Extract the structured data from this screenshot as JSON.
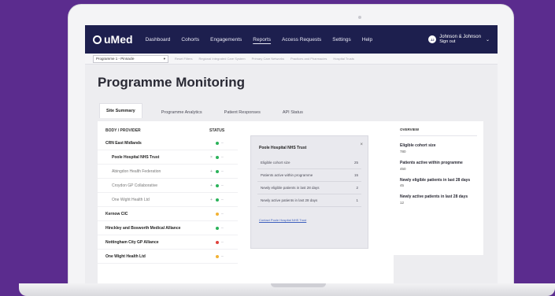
{
  "nav": {
    "logo": "uMed",
    "items": [
      "Dashboard",
      "Cohorts",
      "Engagements",
      "Reports",
      "Access Requests",
      "Settings",
      "Help"
    ],
    "active_index": 3,
    "user_initials": "JJ",
    "user_name": "Johnson & Johnson",
    "user_action": "Sign out"
  },
  "filterbar": {
    "programme_select": "Programme 1 - Pinnacle",
    "chips": [
      "Reset Filters",
      "Regional Integrated Care System",
      "Primary Care Networks",
      "Practices and Pharmacies",
      "Hospital Trusts"
    ]
  },
  "page_title": "Programme Monitoring",
  "tabs": [
    "Site Summary",
    "Programme Analytics",
    "Patient Responses",
    "API Status"
  ],
  "active_tab": 0,
  "table": {
    "headers": [
      "BODY / PROVIDER",
      "STATUS"
    ],
    "rows": [
      {
        "name": "CRN East Midlands",
        "level": "parent",
        "mark": "",
        "color": "#2bb35a"
      },
      {
        "name": "Poole Hospital NHS Trust",
        "level": "child",
        "selected": true,
        "mark": "×",
        "color": "#2bb35a"
      },
      {
        "name": "Abingdon Health Federation",
        "level": "child",
        "mark": "+",
        "color": "#2bb35a"
      },
      {
        "name": "Croydon GP Collaborative",
        "level": "child",
        "mark": "+",
        "color": "#2bb35a"
      },
      {
        "name": "One Wight Health Ltd",
        "level": "child",
        "mark": "+",
        "color": "#2bb35a"
      },
      {
        "name": "Kernow CIC",
        "level": "parent",
        "mark": "",
        "color": "#f2b234"
      },
      {
        "name": "Hinckley and Bosworth Medical Alliance",
        "level": "parent",
        "mark": "",
        "color": "#2bb35a"
      },
      {
        "name": "Nottingham City GP Alliance",
        "level": "parent",
        "mark": "",
        "color": "#e0423d"
      },
      {
        "name": "One Wight Health Ltd",
        "level": "parent",
        "mark": "",
        "color": "#f2b234"
      }
    ]
  },
  "detail": {
    "title": "Poole Hospital NHS Trust",
    "close": "×",
    "rows": [
      {
        "label": "Eligible cohort size",
        "value": "25"
      },
      {
        "label": "Patients active within programme",
        "value": "15"
      },
      {
        "label": "Newly eligible patients in last 28 days",
        "value": "2"
      },
      {
        "label": "Newly active patients in last 28 days",
        "value": "1"
      }
    ],
    "link": "Contact Poole Hospital NHS Trust"
  },
  "overview": {
    "heading": "OVERVIEW",
    "items": [
      {
        "label": "Eligible cohort size",
        "value": "780"
      },
      {
        "label": "Patients active within programme",
        "value": "450"
      },
      {
        "label": "Newly eligible patients in last 28 days",
        "value": "45"
      },
      {
        "label": "Newly active patients in last 28 days",
        "value": "12"
      }
    ]
  }
}
